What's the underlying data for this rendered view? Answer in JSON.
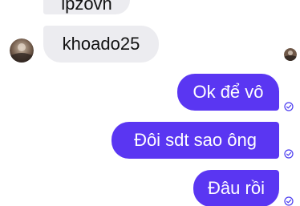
{
  "colors": {
    "outgoing_bubble": "#5a36f2",
    "incoming_bubble": "#ececf0",
    "read_receipt": "#4a3bf0"
  },
  "messages": [
    {
      "direction": "incoming",
      "text": "lpzovn"
    },
    {
      "direction": "incoming",
      "text": "khoado25"
    },
    {
      "direction": "outgoing",
      "text": "Ok để vô"
    },
    {
      "direction": "outgoing",
      "text": "Đôi sdt sao ông"
    },
    {
      "direction": "outgoing",
      "text": "Đâu rồi"
    }
  ],
  "icons": {
    "sender_avatar": "avatar-icon",
    "seen_avatar": "seen-avatar-icon",
    "read_receipt": "check-circle-icon"
  }
}
